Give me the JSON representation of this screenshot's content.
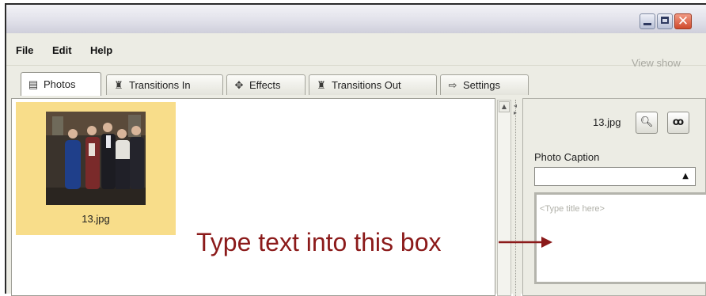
{
  "menu": {
    "file": "File",
    "edit": "Edit",
    "help": "Help"
  },
  "view_show": "View show",
  "tabs": [
    {
      "label": "Photos",
      "icon": "photos-icon"
    },
    {
      "label": "Transitions In",
      "icon": "transitions-in-icon"
    },
    {
      "label": "Effects",
      "icon": "effects-icon"
    },
    {
      "label": "Transitions Out",
      "icon": "transitions-out-icon"
    },
    {
      "label": "Settings",
      "icon": "settings-icon"
    }
  ],
  "active_tab": "Photos",
  "thumbnail": {
    "filename": "13.jpg",
    "selected_color": "#f8dd8a"
  },
  "right_panel": {
    "filename": "13.jpg",
    "zoom_button_icon": "magnifier-icon",
    "find_button_icon": "binoculars-icon",
    "caption_label": "Photo Caption",
    "caption_combo_value": "",
    "title_placeholder": "<Type title here>"
  },
  "callout": {
    "text": "Type text into this box",
    "color": "#8b1a1a"
  }
}
